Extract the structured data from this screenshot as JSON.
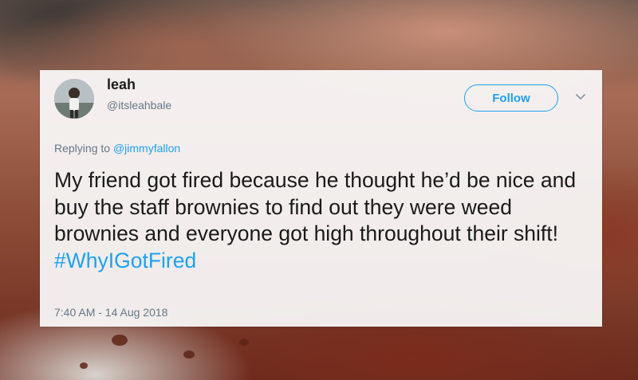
{
  "tweet": {
    "author_name": "leah",
    "author_handle": "@itsleahbale",
    "follow_label": "Follow",
    "replying_to_prefix": "Replying to",
    "replying_to_handle": "@jimmyfallon",
    "text": "My friend got fired because he thought he’d be nice and buy the staff brownies to find out they were weed brownies and everyone got high throughout their shift!",
    "hashtag": "#WhyIGotFired",
    "timestamp": "7:40 AM - 14 Aug 2018"
  },
  "colors": {
    "accent": "#1da1f2",
    "secondary_text": "#657786",
    "primary_text": "#1a1a1a",
    "card_bg": "#fafafa"
  },
  "icons": {
    "avatar": "profile-photo",
    "menu": "chevron-down-icon"
  }
}
